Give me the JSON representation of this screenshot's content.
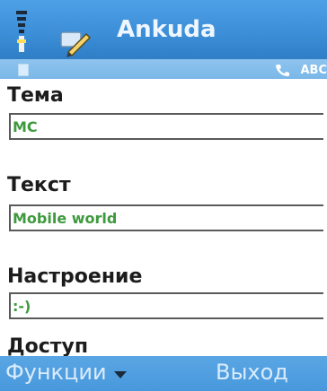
{
  "app": {
    "title": "Ankuda"
  },
  "status": {
    "right_text": "ABC"
  },
  "fields": [
    {
      "label": "Тема",
      "value": "MC"
    },
    {
      "label": "Текст",
      "value": "Mobile world"
    },
    {
      "label": "Настроение",
      "value": ":-)"
    },
    {
      "label": "Доступ"
    }
  ],
  "softkeys": {
    "left": "Функции",
    "right": "Выход"
  },
  "icons": {
    "signal": "signal-strength-icon",
    "pen": "pen-icon",
    "menu_arrow": "chevron-down-icon"
  },
  "colors": {
    "titlebar": "#3c8fd8",
    "statusbar": "#8ec4ee",
    "softkeys": "#4898dc",
    "input_text": "#3d9a3d"
  }
}
